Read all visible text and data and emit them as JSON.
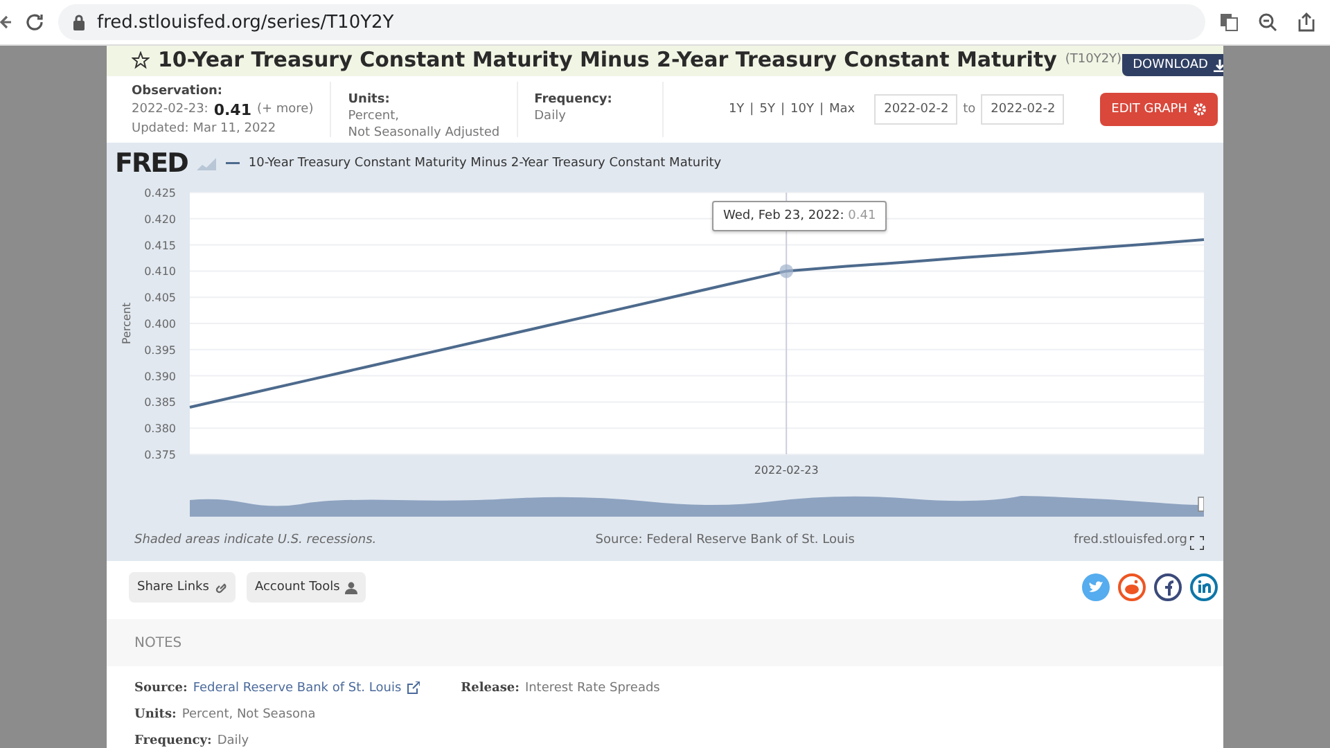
{
  "browser": {
    "url": "fred.stlouisfed.org/series/T10Y2Y"
  },
  "series": {
    "title": "10-Year Treasury Constant Maturity Minus 2-Year Treasury Constant Maturity",
    "code": "(T10Y2Y)",
    "download": "DOWNLOAD"
  },
  "meta": {
    "observation": {
      "label": "Observation:",
      "date": "2022-02-23:",
      "value": "0.41",
      "more": "(+ more)",
      "updated": "Updated: Mar 11, 2022"
    },
    "units": {
      "label": "Units:",
      "lines": [
        "Percent,",
        "Not Seasonally Adjusted"
      ]
    },
    "frequency": {
      "label": "Frequency:",
      "value": "Daily"
    },
    "ranges": [
      "1Y",
      "5Y",
      "10Y",
      "Max"
    ],
    "separator": "|",
    "from": "2022-02-2",
    "to_label": "to",
    "to": "2022-02-2",
    "edit": "EDIT GRAPH"
  },
  "chart": {
    "logo": "FRED",
    "tooltip": {
      "label": "Wed, Feb 23, 2022:",
      "value": "0.41"
    },
    "chart_data": {
      "type": "line",
      "ylabel": "Percent",
      "ylim": [
        0.375,
        0.425
      ],
      "grid": true,
      "annotations": [
        "2022-02-23"
      ],
      "yticks": [
        {
          "value": 0.375,
          "label": "0.375"
        },
        {
          "value": 0.38,
          "label": "0.380"
        },
        {
          "value": 0.385,
          "label": "0.385"
        },
        {
          "value": 0.39,
          "label": "0.390"
        },
        {
          "value": 0.395,
          "label": "0.395"
        },
        {
          "value": 0.4,
          "label": "0.400"
        },
        {
          "value": 0.405,
          "label": "0.405"
        },
        {
          "value": 0.41,
          "label": "0.410"
        },
        {
          "value": 0.415,
          "label": "0.415"
        },
        {
          "value": 0.42,
          "label": "0.420"
        },
        {
          "value": 0.425,
          "label": "0.425"
        }
      ],
      "series": [
        {
          "name": "10-Year Treasury Constant Maturity Minus 2-Year Treasury Constant Maturity",
          "color": "#4d6a8c",
          "values": [
            0.384,
            0.3866,
            0.3892,
            0.3918,
            0.3944,
            0.397,
            0.3996,
            0.4022,
            0.4048,
            0.4074,
            0.41,
            0.4109,
            0.4117,
            0.4126,
            0.4134,
            0.4143,
            0.4151,
            0.416
          ]
        }
      ]
    },
    "recession_note": "Shaded areas indicate U.S. recessions.",
    "source": "Source: Federal Reserve Bank of St. Louis",
    "site": "fred.stlouisfed.org"
  },
  "tools": [
    "Share Links",
    "Account Tools"
  ],
  "notes": {
    "heading": "NOTES",
    "rows": [
      [
        {
          "label": "Source:",
          "value": "Federal Reserve Bank of St. Louis",
          "kind": "link"
        },
        {
          "label": "Release:",
          "value": "Interest Rate Spreads",
          "kind": "text"
        }
      ],
      [
        {
          "label": "Units:",
          "value": "Percent, Not Seasona",
          "kind": "text"
        }
      ],
      [
        {
          "label": "Frequency:",
          "value": "Daily",
          "kind": "text"
        }
      ]
    ]
  }
}
